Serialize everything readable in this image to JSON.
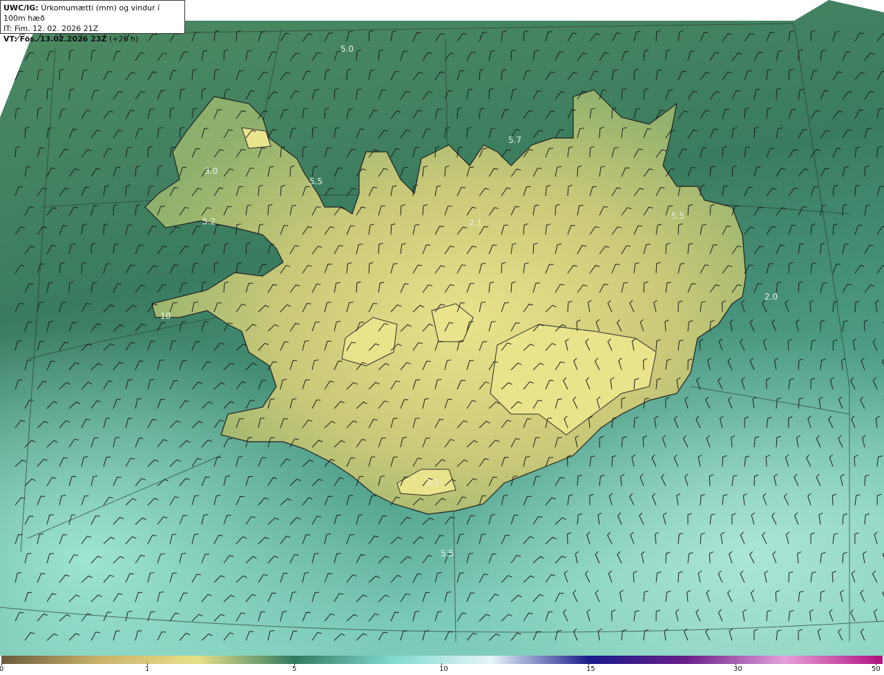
{
  "title": {
    "prefix": "UWC/IG:",
    "text": "Úrkomumætti (mm) og vindur í 100m hæð",
    "it_label": "IT: Fim. 12. 02. 2026 21Z",
    "vt_prefix": "VT: Fös. 13.02.2026 23Z",
    "vt_suffix": "(+26 h)"
  },
  "map_labels": [
    {
      "text": "5.0"
    },
    {
      "text": "5.7"
    },
    {
      "text": "3.0"
    },
    {
      "text": "5.5"
    },
    {
      "text": "5.2"
    },
    {
      "text": "2.1"
    },
    {
      "text": "5.5"
    },
    {
      "text": "2.0"
    },
    {
      "text": "10"
    },
    {
      "text": "2.1"
    },
    {
      "text": "5.5"
    }
  ],
  "colorbar": {
    "ticks": [
      "0",
      "1",
      "5",
      "10",
      "15",
      "30",
      "50"
    ],
    "colors": [
      "#6a5a3c",
      "#c8b26a",
      "#e7e08a",
      "#2f7a60",
      "#7fd9cf",
      "#e6f4f8",
      "#1a1a8a",
      "#6a1e8a",
      "#e6a0d8",
      "#b0107f"
    ]
  },
  "colors": {
    "sea_dark": "#3a7a5c",
    "sea_light": "#8fd8cc",
    "land_high": "#e2de8a",
    "land_low": "#8aa868"
  }
}
